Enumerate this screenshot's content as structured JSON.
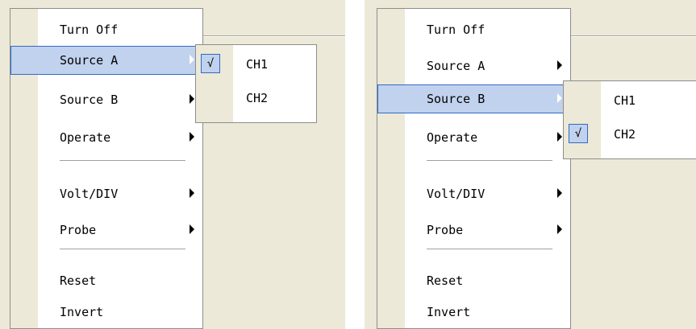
{
  "left": {
    "menu": {
      "items": [
        {
          "label": "Turn Off",
          "arrow": false,
          "selected": false
        },
        {
          "label": "Source A",
          "arrow": true,
          "selected": true
        },
        {
          "label": "Source B",
          "arrow": true,
          "selected": false
        },
        {
          "label": "Operate",
          "arrow": true,
          "selected": false
        },
        {
          "label": "Volt/DIV",
          "arrow": true,
          "selected": false
        },
        {
          "label": "Probe",
          "arrow": true,
          "selected": false
        },
        {
          "label": "Reset",
          "arrow": false,
          "selected": false
        },
        {
          "label": "Invert",
          "arrow": false,
          "selected": false
        }
      ]
    },
    "submenu": {
      "items": [
        {
          "label": "CH1",
          "checked": true,
          "check_glyph": "√"
        },
        {
          "label": "CH2",
          "checked": false,
          "check_glyph": ""
        }
      ]
    }
  },
  "right": {
    "menu": {
      "items": [
        {
          "label": "Turn Off",
          "arrow": false,
          "selected": false
        },
        {
          "label": "Source A",
          "arrow": true,
          "selected": false
        },
        {
          "label": "Source B",
          "arrow": true,
          "selected": true
        },
        {
          "label": "Operate",
          "arrow": true,
          "selected": false
        },
        {
          "label": "Volt/DIV",
          "arrow": true,
          "selected": false
        },
        {
          "label": "Probe",
          "arrow": true,
          "selected": false
        },
        {
          "label": "Reset",
          "arrow": false,
          "selected": false
        },
        {
          "label": "Invert",
          "arrow": false,
          "selected": false
        }
      ]
    },
    "submenu": {
      "items": [
        {
          "label": "CH1",
          "checked": false,
          "check_glyph": ""
        },
        {
          "label": "CH2",
          "checked": true,
          "check_glyph": "√"
        }
      ]
    }
  },
  "colors": {
    "menu_bg": "#ffffff",
    "gutter": "#ece9d8",
    "selection_fill": "#c1d2ee",
    "selection_border": "#316ac5"
  }
}
